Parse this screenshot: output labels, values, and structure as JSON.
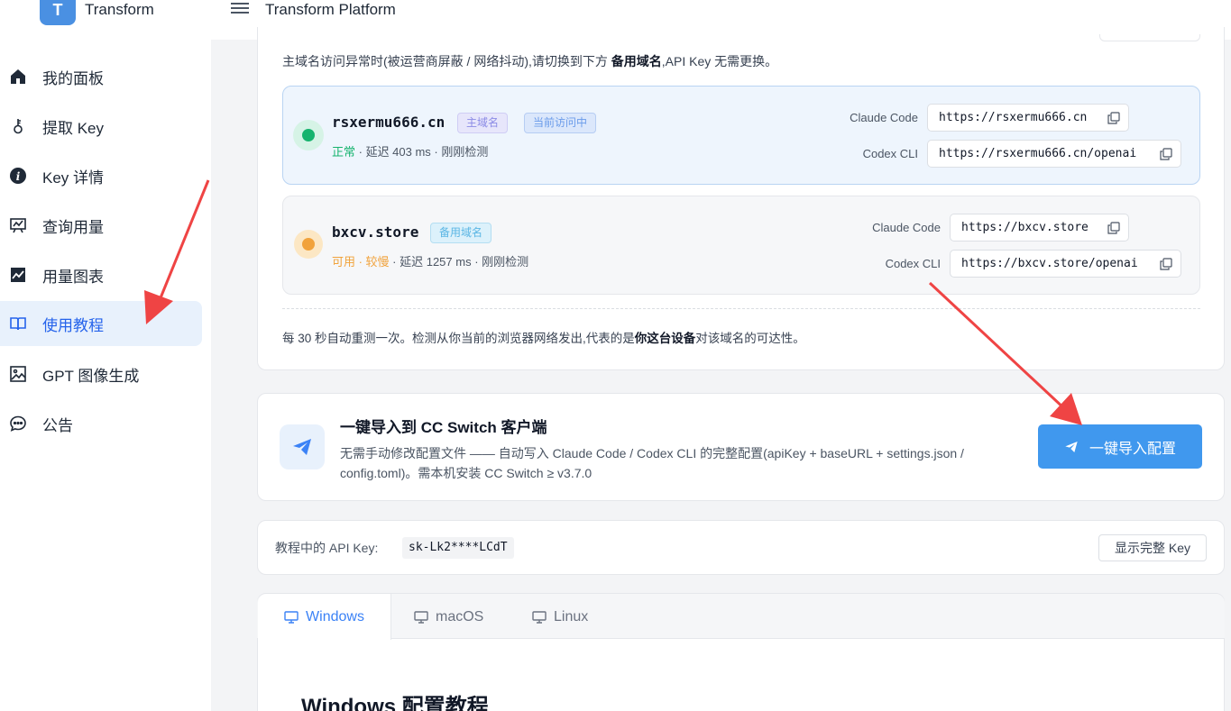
{
  "header": {
    "logo_letter": "T",
    "brand": "Transform",
    "platform_title": "Transform Platform"
  },
  "sidebar": {
    "items": [
      {
        "label": "我的面板",
        "icon": "home-icon"
      },
      {
        "label": "提取 Key",
        "icon": "key-icon"
      },
      {
        "label": "Key 详情",
        "icon": "info-icon"
      },
      {
        "label": "查询用量",
        "icon": "usage-board-icon"
      },
      {
        "label": "用量图表",
        "icon": "line-chart-icon"
      },
      {
        "label": "使用教程",
        "icon": "book-icon",
        "active": true
      },
      {
        "label": "GPT 图像生成",
        "icon": "image-icon"
      },
      {
        "label": "公告",
        "icon": "chat-icon"
      }
    ]
  },
  "domains": {
    "intro_prefix": "主域名访问异常时(被运营商屏蔽 / 网络抖动),请切换到下方 ",
    "intro_bold": "备用域名",
    "intro_suffix": ",API Key 无需更换。",
    "primary": {
      "name": "rsxermu666.cn",
      "tag_main": "主域名",
      "tag_current": "当前访问中",
      "status": "正常",
      "latency": " · 延迟 403 ms · 刚刚检测",
      "claude_label": "Claude Code",
      "claude_url": "https://rsxermu666.cn",
      "codex_label": "Codex CLI",
      "codex_url": "https://rsxermu666.cn/openai"
    },
    "backup": {
      "name": "bxcv.store",
      "tag_backup": "备用域名",
      "status": "可用 · 较慢",
      "latency": " · 延迟 1257 ms · 刚刚检测",
      "claude_label": "Claude Code",
      "claude_url": "https://bxcv.store",
      "codex_label": "Codex CLI",
      "codex_url": "https://bxcv.store/openai"
    },
    "footnote_prefix": "每 30 秒自动重测一次。检测从你当前的浏览器网络发出,代表的是",
    "footnote_bold": "你这台设备",
    "footnote_suffix": "对该域名的可达性。"
  },
  "import": {
    "title": "一键导入到 CC Switch 客户端",
    "description": "无需手动修改配置文件 —— 自动写入 Claude Code / Codex CLI 的完整配置(apiKey + baseURL + settings.json / config.toml)。需本机安装 CC Switch ≥ v3.7.0",
    "button_label": "一键导入配置"
  },
  "api_key": {
    "label": "教程中的 API Key:",
    "value": "sk-Lk2****LCdT",
    "show_button": "显示完整 Key"
  },
  "tabs": {
    "items": [
      "Windows",
      "macOS",
      "Linux"
    ],
    "active": "Windows"
  },
  "content": {
    "title": "Windows 配置教程"
  },
  "colors": {
    "accent": "#4098ee",
    "status_ok": "#16b36e",
    "status_warn": "#f1a23b",
    "annotation_arrow": "#ef4444"
  }
}
